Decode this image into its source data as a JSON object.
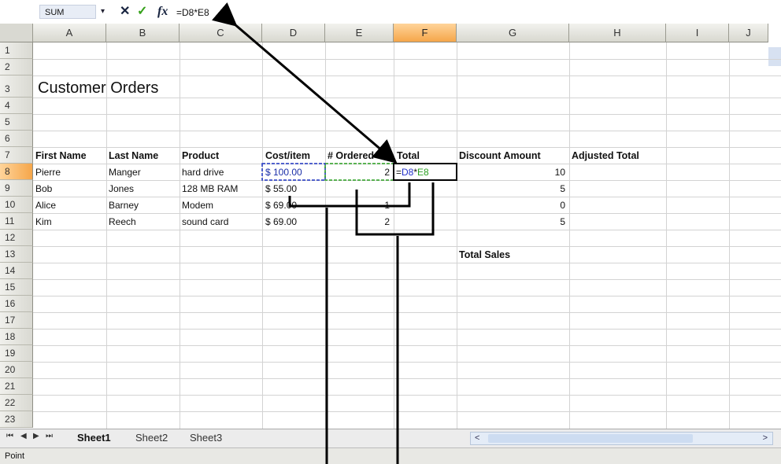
{
  "formula_bar": {
    "name_box": "SUM",
    "dropdown_icon": "▾",
    "cancel_icon": "✕",
    "enter_icon": "✓",
    "function_icon": "fx",
    "formula": "=D8*E8"
  },
  "columns": [
    "A",
    "B",
    "C",
    "D",
    "E",
    "F",
    "G",
    "H",
    "I",
    "J"
  ],
  "active_column": "F",
  "rows": [
    "1",
    "2",
    "3",
    "4",
    "5",
    "6",
    "7",
    "8",
    "9",
    "10",
    "11",
    "12",
    "13",
    "14",
    "15",
    "16",
    "17",
    "18",
    "19",
    "20",
    "21",
    "22",
    "23"
  ],
  "active_row": "8",
  "title": "Customer Orders",
  "headers": {
    "first_name": "First Name",
    "last_name": "Last Name",
    "product": "Product",
    "cost_item": "Cost/item",
    "ordered": "# Ordered",
    "total": "Total",
    "discount": "Discount Amount",
    "adjusted": "Adjusted Total"
  },
  "data_rows": [
    {
      "first": "Pierre",
      "last": "Manger",
      "product": "hard drive",
      "cost": "$ 100.00",
      "ordered": "2",
      "discount": "10"
    },
    {
      "first": "Bob",
      "last": "Jones",
      "product": "128 MB RAM",
      "cost": "$ 55.00",
      "ordered": "",
      "discount": "5"
    },
    {
      "first": "Alice",
      "last": "Barney",
      "product": "Modem",
      "cost": "$ 69.00",
      "ordered": "1",
      "discount": "0"
    },
    {
      "first": "Kim",
      "last": "Reech",
      "product": "sound card",
      "cost": "$ 69.00",
      "ordered": "2",
      "discount": "5"
    }
  ],
  "editing_formula": {
    "eq": "=",
    "ref1": "D8",
    "op": "*",
    "ref2": "E8"
  },
  "total_sales_label": "Total Sales",
  "sheet_tabs": [
    "Sheet1",
    "Sheet2",
    "Sheet3"
  ],
  "active_sheet": "Sheet1",
  "tab_nav": {
    "first": "⏮",
    "prev": "◀",
    "next": "▶",
    "last": "⏭"
  },
  "scroll": {
    "left_arrow": "<",
    "right_arrow": ">"
  },
  "status": "Point"
}
